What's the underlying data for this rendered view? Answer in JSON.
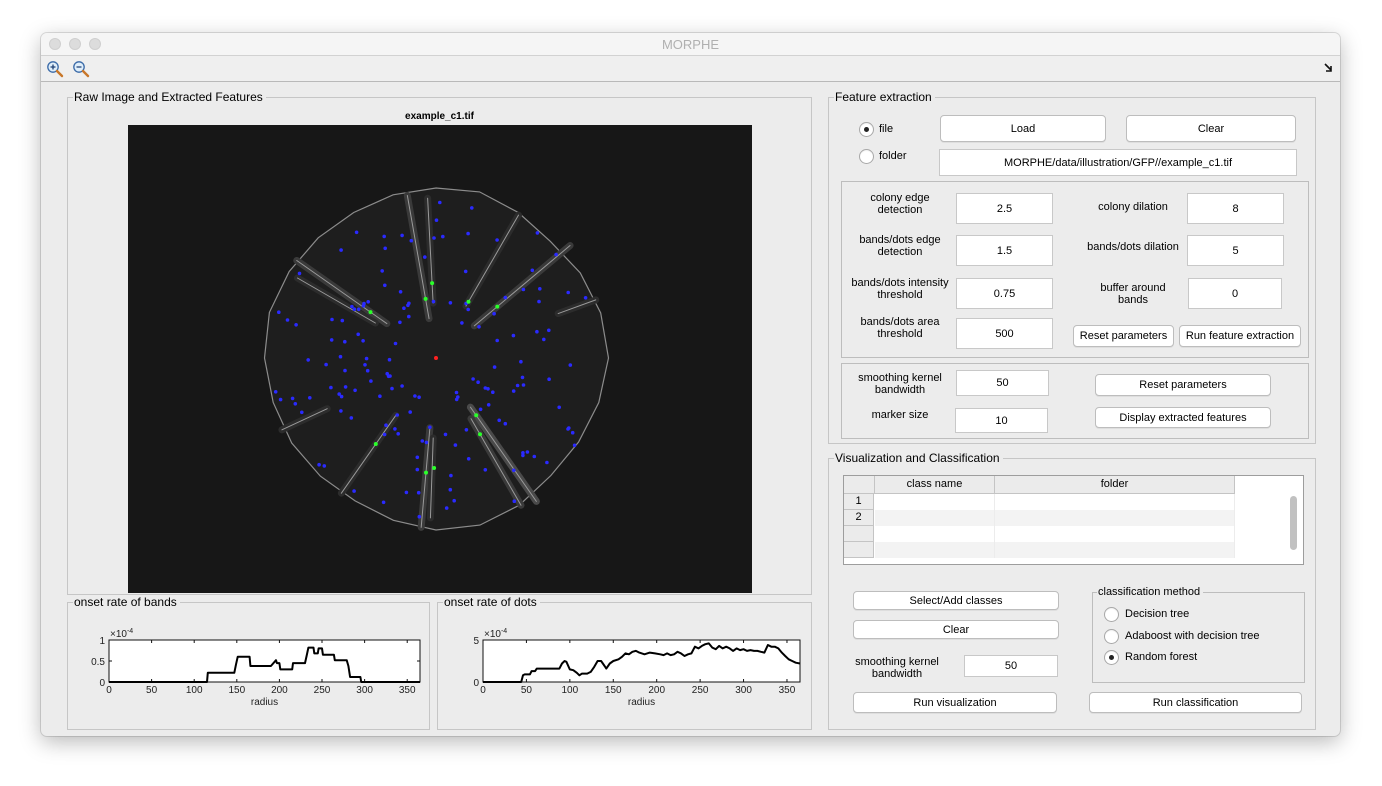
{
  "window": {
    "title": "MORPHE",
    "toolbar": [
      {
        "icon": "zoom-in-icon",
        "label": "Zoom In"
      },
      {
        "icon": "zoom-out-icon",
        "label": "Zoom Out"
      }
    ],
    "dock_icon": "dock-arrow-icon"
  },
  "raw_panel": {
    "title": "Raw Image and Extracted Features",
    "image_title": "example_c1.tif",
    "colors": {
      "background": "#171717",
      "colony_edge": "#8c8c8c",
      "band_outline": "#9a9a9a",
      "dots": "#2a2aff",
      "band_onsets": "#2aff2a",
      "center": "#ff2020"
    }
  },
  "feature_extraction": {
    "title": "Feature extraction",
    "source_options": [
      {
        "label": "file",
        "selected": true
      },
      {
        "label": "folder",
        "selected": false
      }
    ],
    "load_label": "Load",
    "clear_label": "Clear",
    "path_value": "MORPHE/data/illustration/GFP//example_c1.tif",
    "params": {
      "colony_edge_detection": {
        "label_1": "colony edge",
        "label_2": "detection",
        "value": "2.5"
      },
      "colony_dilation": {
        "label": "colony dilation",
        "value": "8"
      },
      "bands_edge_detection": {
        "label_1": "bands/dots edge",
        "label_2": "detection",
        "value": "1.5"
      },
      "bands_dilation": {
        "label": "bands/dots dilation",
        "value": "5"
      },
      "intensity_threshold": {
        "label_1": "bands/dots intensity",
        "label_2": "threshold",
        "value": "0.75"
      },
      "buffer_around_bands": {
        "label_1": "buffer around",
        "label_2": "bands",
        "value": "0"
      },
      "area_threshold": {
        "label_1": "bands/dots area",
        "label_2": "threshold",
        "value": "500"
      }
    },
    "reset_params_label": "Reset parameters",
    "run_extraction_label": "Run feature extraction",
    "display": {
      "kernel_label_1": "smoothing kernel",
      "kernel_label_2": "bandwidth",
      "kernel_value": "50",
      "marker_label": "marker size",
      "marker_value": "10",
      "reset_label": "Reset parameters",
      "display_label": "Display extracted features"
    }
  },
  "vis_class": {
    "title": "Visualization and Classification",
    "table": {
      "columns": [
        "class name",
        "folder"
      ],
      "row_headers": [
        "1",
        "2",
        "",
        ""
      ],
      "rows": [
        [
          "",
          ""
        ],
        [
          "",
          ""
        ],
        [
          "",
          ""
        ],
        [
          "",
          ""
        ]
      ]
    },
    "select_add_label": "Select/Add classes",
    "clear_label": "Clear",
    "kernel_label_1": "smoothing kernel",
    "kernel_label_2": "bandwidth",
    "kernel_value": "50",
    "run_vis_label": "Run visualization",
    "method": {
      "title": "classification method",
      "options": [
        {
          "label": "Decision tree",
          "selected": false
        },
        {
          "label": "Adaboost with decision tree",
          "selected": false
        },
        {
          "label": "Random forest",
          "selected": true
        }
      ]
    },
    "run_class_label": "Run classification"
  },
  "chart_data": [
    {
      "type": "line",
      "panel_title": "onset rate of bands",
      "title": "",
      "xlabel": "radius",
      "ylabel": "",
      "y_exponent_label": "×10",
      "y_exponent": "-4",
      "xlim": [
        0,
        365
      ],
      "ylim": [
        0,
        1
      ],
      "xticks": [
        0,
        50,
        100,
        150,
        200,
        250,
        300,
        350
      ],
      "yticks": [
        0,
        0.5,
        1
      ],
      "ytick_labels": [
        "0",
        "0.5",
        "1"
      ],
      "grid": false,
      "step": true,
      "x": [
        0,
        115,
        116,
        147,
        149,
        151,
        165,
        166,
        190,
        196,
        197,
        200,
        201,
        215,
        216,
        230,
        232,
        234,
        240,
        241,
        245,
        246,
        250,
        251,
        264,
        265,
        279,
        281,
        283,
        295,
        296,
        365
      ],
      "y": [
        0,
        0,
        0.22,
        0.22,
        0.42,
        0.6,
        0.6,
        0.38,
        0.38,
        0.52,
        0.45,
        0.45,
        0.3,
        0.3,
        0.45,
        0.45,
        0.63,
        0.82,
        0.82,
        0.68,
        0.68,
        0.8,
        0.8,
        0.65,
        0.65,
        0.52,
        0.52,
        0.38,
        0.12,
        0.12,
        0,
        0
      ]
    },
    {
      "type": "line",
      "panel_title": "onset rate of dots",
      "title": "",
      "xlabel": "radius",
      "ylabel": "",
      "y_exponent_label": "×10",
      "y_exponent": "-4",
      "xlim": [
        0,
        365
      ],
      "ylim": [
        0,
        5
      ],
      "xticks": [
        0,
        50,
        100,
        150,
        200,
        250,
        300,
        350
      ],
      "yticks": [
        0,
        5
      ],
      "ytick_labels": [
        "0",
        "5"
      ],
      "grid": false,
      "step": false,
      "x": [
        0,
        44,
        46,
        48,
        54,
        56,
        60,
        62,
        70,
        80,
        88,
        91,
        94,
        96,
        100,
        104,
        108,
        111,
        114,
        120,
        124,
        128,
        132,
        136,
        140,
        142,
        146,
        150,
        156,
        160,
        164,
        168,
        172,
        176,
        180,
        186,
        192,
        198,
        204,
        208,
        212,
        216,
        220,
        224,
        228,
        232,
        236,
        240,
        244,
        248,
        252,
        256,
        260,
        264,
        268,
        272,
        276,
        280,
        284,
        288,
        292,
        296,
        300,
        304,
        308,
        312,
        316,
        320,
        324,
        328,
        332,
        336,
        340,
        344,
        348,
        352,
        356,
        360,
        365
      ],
      "y": [
        0,
        0,
        0.8,
        0.9,
        0.9,
        1.3,
        1.3,
        1.6,
        1.6,
        1.6,
        1.6,
        2.2,
        2.5,
        2.4,
        1.5,
        1.4,
        1.1,
        0.8,
        1.0,
        1.0,
        1.2,
        1.8,
        2.5,
        2.5,
        1.9,
        1.6,
        2.2,
        2.5,
        2.7,
        3.0,
        3.4,
        3.3,
        3.6,
        3.7,
        3.5,
        3.3,
        3.5,
        3.4,
        3.3,
        3.2,
        3.4,
        3.2,
        3.3,
        3.6,
        3.4,
        3.1,
        3.3,
        3.4,
        4.2,
        4.0,
        4.3,
        4.5,
        4.6,
        4.1,
        3.9,
        4.3,
        4.0,
        4.2,
        4.0,
        3.7,
        4.0,
        3.8,
        3.9,
        3.7,
        3.8,
        3.7,
        3.7,
        3.6,
        3.5,
        4.4,
        4.2,
        4.2,
        4.0,
        3.5,
        3.1,
        2.7,
        2.5,
        2.3,
        2.2
      ]
    }
  ]
}
